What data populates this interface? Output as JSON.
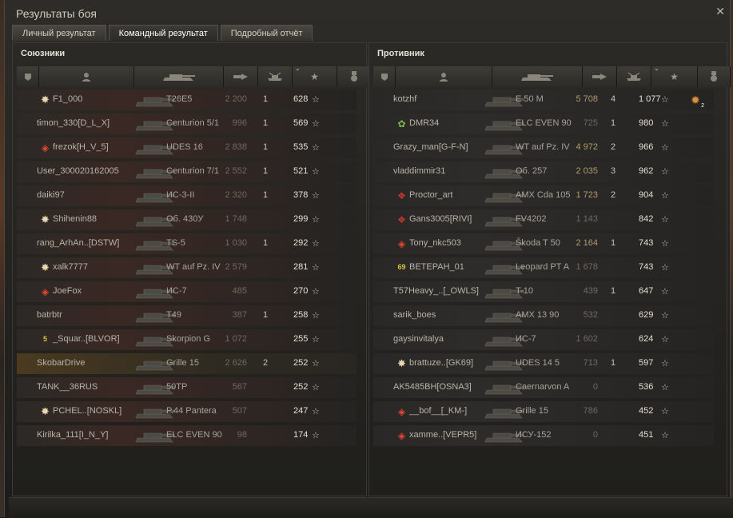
{
  "window": {
    "title": "Результаты боя"
  },
  "tabs": [
    {
      "label": "Личный результат"
    },
    {
      "label": "Командный результат"
    },
    {
      "label": "Подробный отчёт"
    }
  ],
  "allies": {
    "title": "Союзники",
    "rows": [
      {
        "player": "F1_000",
        "badge": "cross",
        "vehicle": "T26E5",
        "damage": "2 200",
        "kills": "1",
        "xp": "628"
      },
      {
        "player": "timon_330[D_L_X]",
        "badge": "",
        "vehicle": "Centurion 5/1",
        "damage": "996",
        "kills": "1",
        "xp": "569"
      },
      {
        "player": "frezok[H_V_5]",
        "badge": "diamond",
        "vehicle": "UDES 16",
        "damage": "2 838",
        "kills": "1",
        "xp": "535"
      },
      {
        "player": "User_300020162005",
        "badge": "",
        "vehicle": "Centurion 7/1",
        "damage": "2 552",
        "kills": "1",
        "xp": "521"
      },
      {
        "player": "daiki97",
        "badge": "",
        "vehicle": "ИС-3-II",
        "damage": "2 320",
        "kills": "1",
        "xp": "378"
      },
      {
        "player": "Shihenin88",
        "badge": "cross",
        "vehicle": "Об. 430У",
        "damage": "1 748",
        "kills": "",
        "xp": "299"
      },
      {
        "player": "rang_ArhAn..[DSTW]",
        "badge": "",
        "vehicle": "TS-5",
        "damage": "1 030",
        "kills": "1",
        "xp": "292"
      },
      {
        "player": "xalk7777",
        "badge": "cross",
        "vehicle": "WT auf Pz. IV",
        "damage": "2 579",
        "kills": "",
        "xp": "281"
      },
      {
        "player": "JoeFox",
        "badge": "diamond",
        "vehicle": "ИС-7",
        "damage": "485",
        "kills": "",
        "xp": "270"
      },
      {
        "player": "batrbtr",
        "badge": "",
        "vehicle": "T49",
        "damage": "387",
        "kills": "1",
        "xp": "258"
      },
      {
        "player": "_Squar..[BLVOR]",
        "badge": "num",
        "badge_text": "5",
        "vehicle": "Skorpion G",
        "damage": "1 072",
        "kills": "",
        "xp": "255"
      },
      {
        "player": "SkobarDrive",
        "badge": "",
        "vehicle": "Grille 15",
        "damage": "2 626",
        "kills": "2",
        "xp": "252",
        "self": true
      },
      {
        "player": "TANK__36RUS",
        "badge": "",
        "vehicle": "50TP",
        "damage": "567",
        "kills": "",
        "xp": "252"
      },
      {
        "player": "PCHEL..[NOSKL]",
        "badge": "cross",
        "vehicle": "P.44 Pantera",
        "damage": "507",
        "kills": "",
        "xp": "247"
      },
      {
        "player": "Kirilka_111[I_N_Y]",
        "badge": "",
        "vehicle": "ELC EVEN 90",
        "damage": "98",
        "kills": "",
        "xp": "174"
      }
    ]
  },
  "enemies": {
    "title": "Противник",
    "rows": [
      {
        "player": "kotzhf",
        "badge": "",
        "vehicle": "E 50 M",
        "damage": "5 708",
        "kills": "4",
        "xp": "1 077",
        "medal": "2"
      },
      {
        "player": "DMR34",
        "badge": "gear",
        "vehicle": "ELC EVEN 90",
        "damage": "725",
        "kills": "1",
        "xp": "980"
      },
      {
        "player": "Grazy_man[G-F-N]",
        "badge": "",
        "vehicle": "WT auf Pz. IV",
        "damage": "4 972",
        "kills": "2",
        "xp": "966"
      },
      {
        "player": "vladdimmir31",
        "badge": "",
        "vehicle": "Об. 257",
        "damage": "2 035",
        "kills": "3",
        "xp": "962"
      },
      {
        "player": "Proctor_art",
        "badge": "red",
        "vehicle": "AMX Cda 105",
        "damage": "1 723",
        "kills": "2",
        "xp": "904"
      },
      {
        "player": "Gans3005[RIVI]",
        "badge": "red",
        "vehicle": "FV4202",
        "damage": "1 143",
        "kills": "",
        "xp": "842"
      },
      {
        "player": "Tony_nkc503",
        "badge": "diamond",
        "vehicle": "Škoda T 50",
        "damage": "2 164",
        "kills": "1",
        "xp": "743"
      },
      {
        "player": "BETEPAH_01",
        "badge": "num",
        "badge_text": "69",
        "vehicle": "Leopard PT A",
        "damage": "1 678",
        "kills": "",
        "xp": "743"
      },
      {
        "player": "T57Heavy_..[_OWLS]",
        "badge": "",
        "vehicle": "T-10",
        "damage": "439",
        "kills": "1",
        "xp": "647"
      },
      {
        "player": "sarik_boes",
        "badge": "",
        "vehicle": "AMX 13 90",
        "damage": "532",
        "kills": "",
        "xp": "629"
      },
      {
        "player": "gaysinvitalya",
        "badge": "",
        "vehicle": "ИС-7",
        "damage": "1 602",
        "kills": "",
        "xp": "624"
      },
      {
        "player": "brattuze..[GK69]",
        "badge": "cross",
        "vehicle": "UDES 14 5",
        "damage": "713",
        "kills": "1",
        "xp": "597"
      },
      {
        "player": "AK5485BH[OSNA3]",
        "badge": "",
        "vehicle": "Caernarvon A",
        "damage": "0",
        "kills": "",
        "xp": "536"
      },
      {
        "player": "__bof__[_KM-]",
        "badge": "diamond",
        "vehicle": "Grille 15",
        "damage": "786",
        "kills": "",
        "xp": "452"
      },
      {
        "player": "xamme..[VEPR5]",
        "badge": "diamond",
        "vehicle": "ИСУ-152",
        "damage": "0",
        "kills": "",
        "xp": "451"
      }
    ]
  },
  "icons": {
    "close": "close-icon",
    "platoon": "platoon-icon",
    "player": "player-icon",
    "vehicle": "tank-icon",
    "damage": "damage-icon",
    "kills": "kills-icon",
    "xp": "xp-star-icon",
    "medal": "medal-icon"
  },
  "colors": {
    "accent_damage_high": "#b09a6a",
    "self_row": "#4a3a20",
    "allies_row": "#2c2926",
    "enemies_row": "#2a2827"
  }
}
